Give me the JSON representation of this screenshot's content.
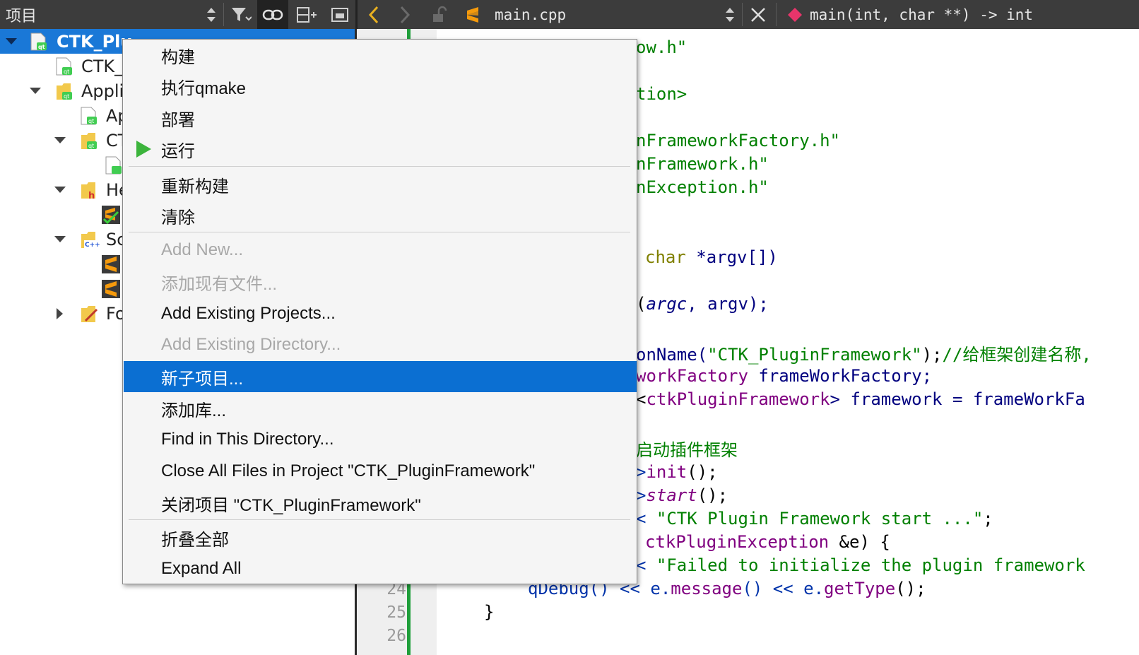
{
  "toolbar": {
    "panel_title": "项目",
    "editor_file": "main.cpp",
    "symbol": "main(int, char **) -> int",
    "accent": "#1a78d7"
  },
  "tree": {
    "items": [
      {
        "label": "CTK_PluginFramework",
        "visible": "CTK_Plu",
        "icon": "qt-project-icon",
        "selected": true
      },
      {
        "label": "CTK_",
        "icon": "qt-file-icon"
      },
      {
        "label": "Appli",
        "icon": "qt-folder-icon"
      },
      {
        "label": "Ap",
        "icon": "qt-file-icon"
      },
      {
        "label": "CT",
        "icon": "qt-folder-icon"
      },
      {
        "label": "",
        "icon": "qt-file-icon"
      },
      {
        "label": "He",
        "icon": "header-folder-icon"
      },
      {
        "label": "",
        "icon": "header-file-icon"
      },
      {
        "label": "Sc",
        "icon": "source-folder-icon"
      },
      {
        "label": "",
        "icon": "sublime-file-icon"
      },
      {
        "label": "",
        "icon": "sublime-file-icon"
      },
      {
        "label": "Fo",
        "icon": "forms-folder-icon"
      }
    ]
  },
  "editor": {
    "line_numbers": [
      "24",
      "25",
      "26"
    ],
    "code": {
      "l1": "ow.h\"",
      "l2": "tion>",
      "l3": "nFrameworkFactory.h\"",
      "l4": "nFramework.h\"",
      "l5": "nException.h\"",
      "l6_kw": "char",
      "l6_rest": " *argv[])",
      "l7_a": "(",
      "l7_b": "argc",
      "l7_c": ", argv);",
      "l8_a": "onName(",
      "l8_str": "\"CTK_PluginFramework\"",
      "l8_b": ");",
      "l8_cmt": "//给框架创建名称,",
      "l9_a": "workFactory",
      "l9_b": " frameWorkFactory;",
      "l10_a": "<",
      "l10_b": "ctkPluginFramework",
      "l10_c": "> framework = frameWorkFa",
      "l11_cmt": "启动插件框架",
      "l12_a": ">",
      "l12_b": "init",
      "l12_c": "();",
      "l13_a": ">",
      "l13_b": "start",
      "l13_c": "();",
      "l14_a": "< ",
      "l14_str": "\"CTK Plugin Framework start ...\"",
      "l14_b": ";",
      "l15_a": "ctkPluginException",
      "l15_b": " &e) {",
      "l16_a": "< ",
      "l16_str": "\"Failed to initialize the plugin framework",
      "l17_a": "qDebug",
      "l17_b": "() << e.",
      "l17_c": "message",
      "l17_d": "() << e.",
      "l17_e": "getType",
      "l17_f": "();",
      "l18": "}"
    }
  },
  "context_menu": {
    "items": [
      {
        "label": "构建",
        "enabled": true
      },
      {
        "label": "执行qmake",
        "enabled": true
      },
      {
        "label": "部署",
        "enabled": true
      },
      {
        "label": "运行",
        "enabled": true,
        "icon": "run-icon"
      },
      {
        "label": "重新构建",
        "enabled": true
      },
      {
        "label": "清除",
        "enabled": true
      },
      {
        "label": "Add New...",
        "enabled": false
      },
      {
        "label": "添加现有文件...",
        "enabled": false
      },
      {
        "label": "Add Existing Projects...",
        "enabled": true
      },
      {
        "label": "Add Existing Directory...",
        "enabled": false
      },
      {
        "label": "新子项目...",
        "enabled": true,
        "highlighted": true
      },
      {
        "label": "添加库...",
        "enabled": true
      },
      {
        "label": "Find in This Directory...",
        "enabled": true
      },
      {
        "label": "Close All Files in Project \"CTK_PluginFramework\"",
        "enabled": true
      },
      {
        "label": "关闭项目 \"CTK_PluginFramework\"",
        "enabled": true
      },
      {
        "label": "折叠全部",
        "enabled": true
      },
      {
        "label": "Expand All",
        "enabled": true
      }
    ]
  }
}
